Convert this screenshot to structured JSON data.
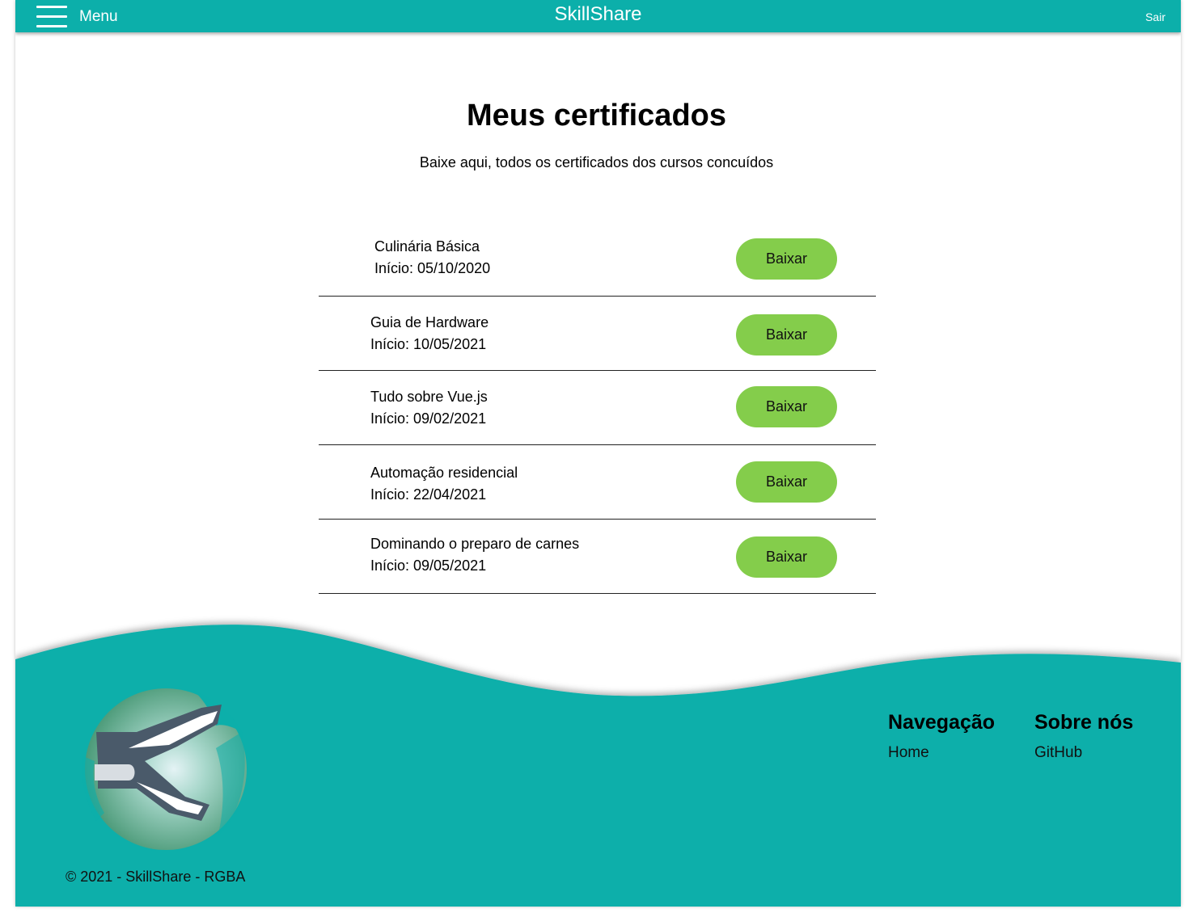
{
  "header": {
    "menu_label": "Menu",
    "brand": "SkillShare",
    "logout_label": "Sair"
  },
  "main": {
    "title": "Meus certificados",
    "subtitle": "Baixe aqui, todos os certificados dos cursos concuídos",
    "certificates": [
      {
        "name": "Culinária Básica",
        "start": "Início: 05/10/2020",
        "button_label": "Baixar"
      },
      {
        "name": "Guia de Hardware",
        "start": "Início: 10/05/2021",
        "button_label": "Baixar"
      },
      {
        "name": "Tudo sobre Vue.js",
        "start": "Início: 09/02/2021",
        "button_label": "Baixar"
      },
      {
        "name": "Automação residencial",
        "start": "Início: 22/04/2021",
        "button_label": "Baixar"
      },
      {
        "name": "Dominando o preparo de carnes",
        "start": "Início: 09/05/2021",
        "button_label": "Baixar"
      }
    ]
  },
  "footer": {
    "copyright": "© 2021 - SkillShare - RGBA",
    "navigation": {
      "title": "Navegação",
      "links": [
        "Home"
      ]
    },
    "about": {
      "title": "Sobre nós",
      "links": [
        "GitHub"
      ]
    }
  },
  "colors": {
    "primary": "#0cafaa",
    "button": "#84cd4b",
    "background": "#ffffff"
  },
  "icons": [
    "hamburger-menu-icon",
    "skillshare-logo"
  ]
}
